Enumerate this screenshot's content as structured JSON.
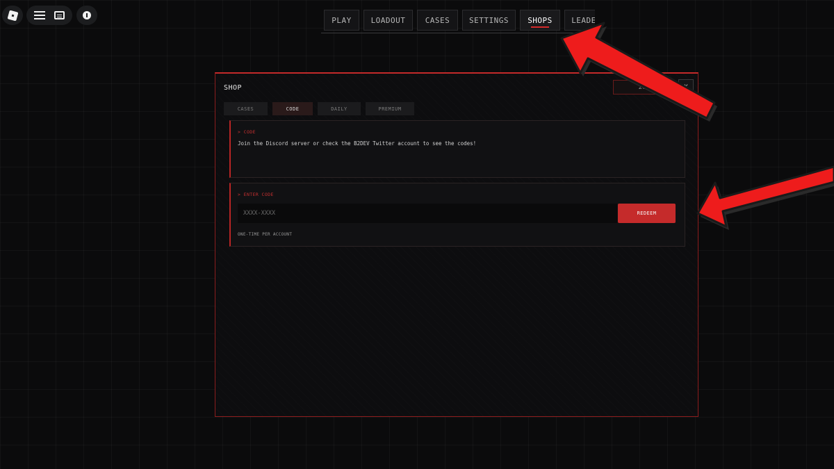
{
  "roblox_controls": {
    "logo_icon": "roblox-logo-icon",
    "menu_icon": "hamburger-menu-icon",
    "chat_icon": "chat-icon",
    "info_icon": "info-icon"
  },
  "top_nav": {
    "tabs": [
      {
        "label": "PLAY"
      },
      {
        "label": "LOADOUT"
      },
      {
        "label": "CASES"
      },
      {
        "label": "SETTINGS"
      },
      {
        "label": "SHOPS",
        "active": true
      },
      {
        "label": "LEADE"
      }
    ]
  },
  "shop": {
    "title": "SHOP",
    "currency": "20",
    "close_label": "X",
    "sub_tabs": [
      {
        "label": "CASES"
      },
      {
        "label": "CODE",
        "active": true
      },
      {
        "label": "DAILY"
      },
      {
        "label": "PREMIUM"
      }
    ],
    "code_panel": {
      "heading": "> CODE",
      "description": "Join the Discord server or check the B2DEV Twitter account to see the codes!"
    },
    "enter_panel": {
      "heading": "> ENTER CODE",
      "input_placeholder": "XXXX-XXXX",
      "input_value": "",
      "redeem_label": "REDEEM",
      "note": "ONE-TIME PER ACCOUNT"
    }
  },
  "colors": {
    "accent": "#c52b2b",
    "background": "#0b0b0c",
    "panel": "#111113"
  }
}
